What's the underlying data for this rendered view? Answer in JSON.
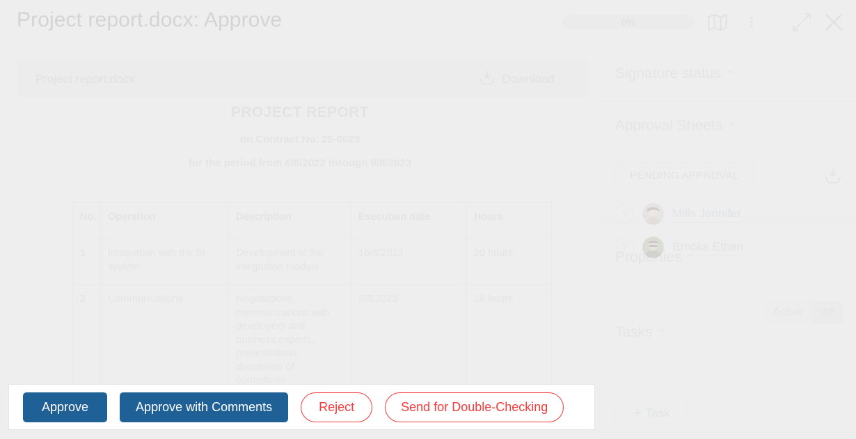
{
  "window": {
    "title": "Project report.docx: Approve",
    "progress_label": "0%",
    "progress_percent": 0,
    "icons": {
      "map": "map-icon",
      "kebab": "more-options-icon",
      "expand": "expand-icon",
      "close": "close-icon"
    }
  },
  "file_bar": {
    "file_name": "Project report.docx",
    "download_label": "Download"
  },
  "document": {
    "heading": "PROJECT REPORT",
    "contract_line": "on Contract No. 25-0023",
    "period_line": "for the period from 6/8/2022 through 9/8/2023",
    "table": {
      "columns": [
        "No.",
        "Operation",
        "Description",
        "Execution date",
        "Hours"
      ],
      "rows": [
        {
          "no": "1",
          "operation": "Integration with the BI system",
          "description": "Development of the integration module",
          "execution_date": "16/8/2023",
          "hours": "20 hours"
        },
        {
          "no": "2",
          "operation": "Communications",
          "description": "Negotiations, communications with developers and business experts, presentations, discussion of corrections",
          "execution_date": "9/8/2023",
          "hours": "18 hours"
        }
      ]
    }
  },
  "sidebar": {
    "signature_status": {
      "title": "Signature status"
    },
    "approval_sheets": {
      "title": "Approval Sheets",
      "status_badge": "PENDING APPROVAL",
      "download_icon": "download-icon",
      "approvers": [
        {
          "name": "Mills Jennifer",
          "status_icon": "question-mark-icon"
        },
        {
          "name": "Brooks Ethan",
          "status_icon": "question-mark-icon"
        }
      ]
    },
    "properties": {
      "title": "Properties"
    },
    "tasks": {
      "title": "Tasks",
      "filters": [
        {
          "label": "Active",
          "selected": false
        },
        {
          "label": "All",
          "selected": true
        }
      ],
      "add_task_label": "Task",
      "add_task_plus": "+"
    }
  },
  "action_bar": {
    "buttons": [
      {
        "label": "Approve",
        "style": "primary"
      },
      {
        "label": "Approve with Comments",
        "style": "primary"
      },
      {
        "label": "Reject",
        "style": "danger"
      },
      {
        "label": "Send for Double-Checking",
        "style": "danger"
      }
    ]
  },
  "colors": {
    "primary": "#1f6196",
    "danger": "#f53b3b",
    "background": "#eeeeee",
    "surface": "#ffffff"
  }
}
